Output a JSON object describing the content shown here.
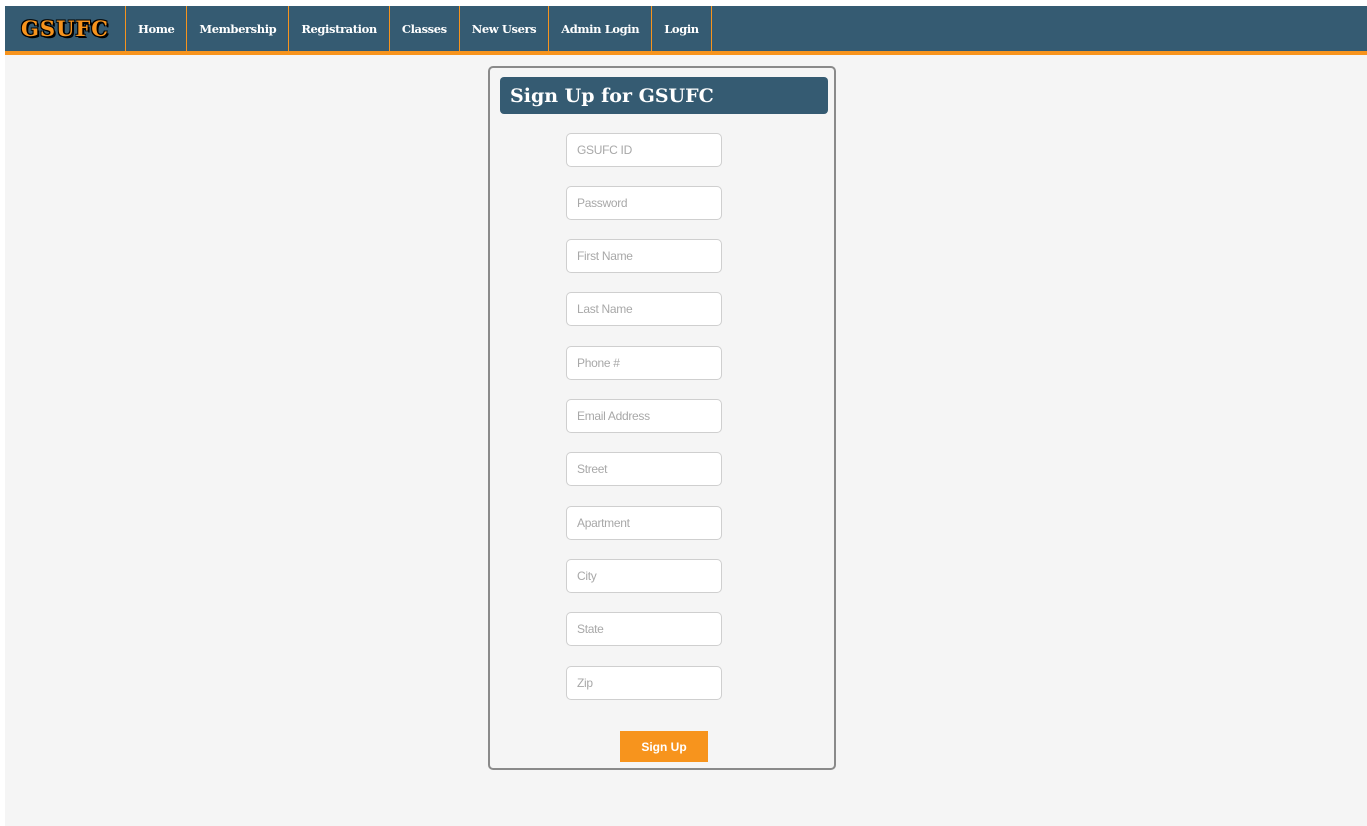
{
  "navbar": {
    "brand": "GSUFC",
    "items": [
      {
        "label": "Home"
      },
      {
        "label": "Membership"
      },
      {
        "label": "Registration"
      },
      {
        "label": "Classes"
      },
      {
        "label": "New Users"
      },
      {
        "label": "Admin Login"
      },
      {
        "label": "Login"
      }
    ]
  },
  "form": {
    "title": "Sign Up for GSUFC",
    "fields": [
      {
        "placeholder": "GSUFC ID",
        "value": ""
      },
      {
        "placeholder": "Password",
        "value": ""
      },
      {
        "placeholder": "First Name",
        "value": ""
      },
      {
        "placeholder": "Last Name",
        "value": ""
      },
      {
        "placeholder": "Phone #",
        "value": ""
      },
      {
        "placeholder": "Email Address",
        "value": ""
      },
      {
        "placeholder": "Street",
        "value": ""
      },
      {
        "placeholder": "Apartment",
        "value": ""
      },
      {
        "placeholder": "City",
        "value": ""
      },
      {
        "placeholder": "State",
        "value": ""
      },
      {
        "placeholder": "Zip",
        "value": ""
      }
    ],
    "submit_label": "Sign Up"
  },
  "colors": {
    "navbar_bg": "#355b72",
    "accent": "#f7941d",
    "page_bg": "#f5f5f5"
  }
}
